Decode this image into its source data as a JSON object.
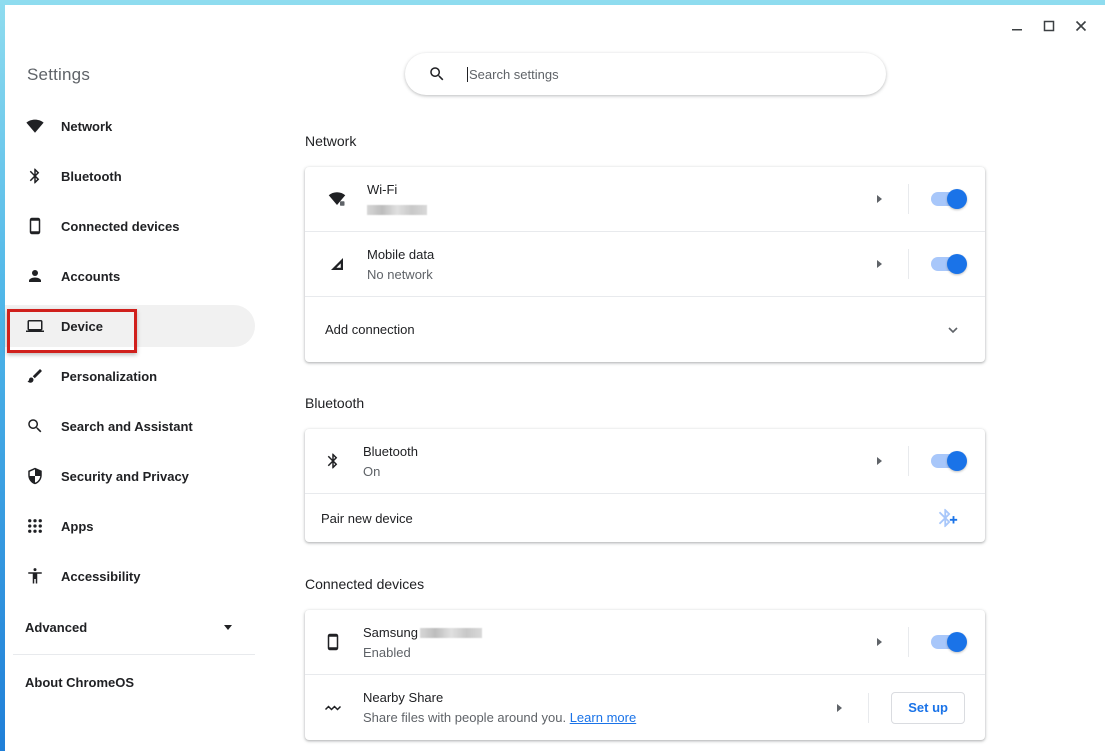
{
  "window": {
    "controls": {
      "minimize": "minimize",
      "maximize": "maximize",
      "close": "close"
    }
  },
  "sidebar": {
    "title": "Settings",
    "items": [
      {
        "label": "Network",
        "icon": "wifi-icon",
        "active": false
      },
      {
        "label": "Bluetooth",
        "icon": "bluetooth-icon",
        "active": false
      },
      {
        "label": "Connected devices",
        "icon": "phone-icon",
        "active": false
      },
      {
        "label": "Accounts",
        "icon": "person-icon",
        "active": false
      },
      {
        "label": "Device",
        "icon": "laptop-icon",
        "active": true
      },
      {
        "label": "Personalization",
        "icon": "brush-icon",
        "active": false
      },
      {
        "label": "Search and Assistant",
        "icon": "search-icon",
        "active": false
      },
      {
        "label": "Security and Privacy",
        "icon": "shield-icon",
        "active": false
      },
      {
        "label": "Apps",
        "icon": "apps-grid-icon",
        "active": false
      },
      {
        "label": "Accessibility",
        "icon": "accessibility-icon",
        "active": false
      }
    ],
    "advanced_label": "Advanced",
    "about_label": "About ChromeOS",
    "highlight_color": "#d0201c"
  },
  "search": {
    "placeholder": "Search settings",
    "value": ""
  },
  "sections": {
    "network": {
      "title": "Network",
      "wifi": {
        "title": "Wi-Fi",
        "subtitle_redacted": true,
        "enabled": true
      },
      "mobile": {
        "title": "Mobile data",
        "subtitle": "No network",
        "enabled": true
      },
      "add_connection": "Add connection"
    },
    "bluetooth": {
      "title": "Bluetooth",
      "bluetooth": {
        "title": "Bluetooth",
        "subtitle": "On",
        "enabled": true
      },
      "pair_new_device": "Pair new device"
    },
    "connected_devices": {
      "title": "Connected devices",
      "phone": {
        "title": "Samsung",
        "title_suffix_redacted": true,
        "subtitle": "Enabled",
        "enabled": true
      },
      "nearby": {
        "title": "Nearby Share",
        "subtitle": "Share files with people around you.",
        "link": "Learn more",
        "button": "Set up"
      }
    }
  },
  "colors": {
    "accent": "#1a73e8",
    "toggle_track": "#a8c7fa",
    "active_nav_bg": "#f1f1f1"
  }
}
